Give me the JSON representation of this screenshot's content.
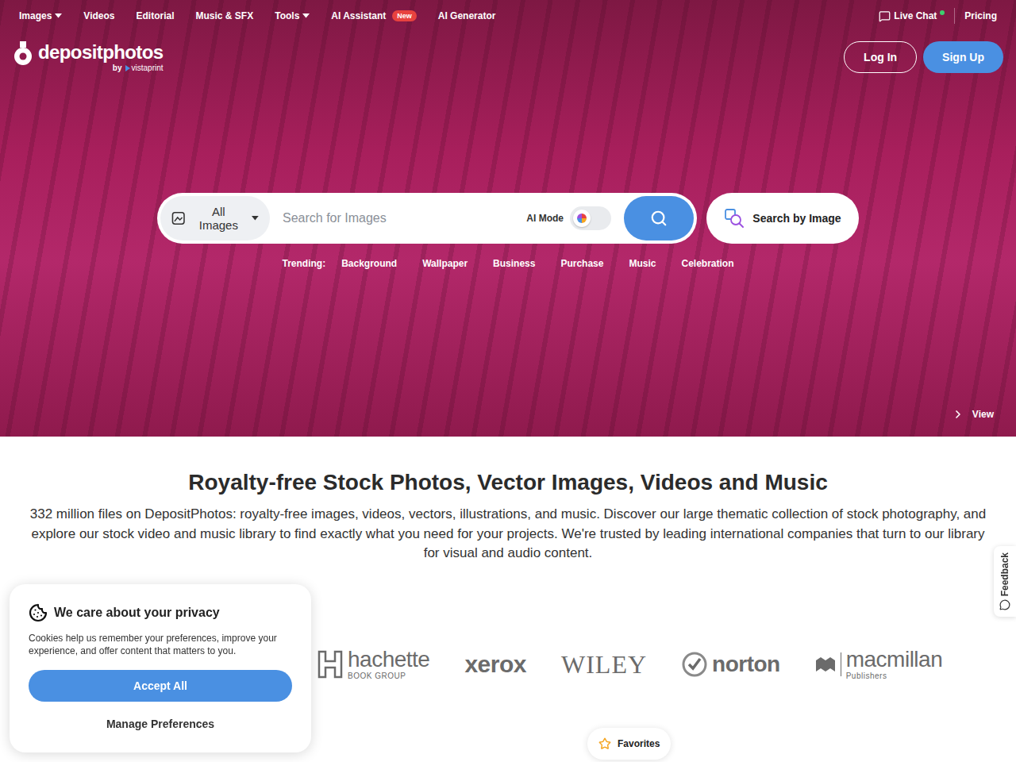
{
  "nav": [
    {
      "label": "Images",
      "kind": "dropdown"
    },
    {
      "label": "Videos",
      "kind": "link"
    },
    {
      "label": "Editorial",
      "kind": "link"
    },
    {
      "label": "Music & SFX",
      "kind": "link"
    },
    {
      "label": "Tools",
      "kind": "dropdown"
    },
    {
      "label": "AI Assistant",
      "kind": "badge",
      "badge": "New"
    },
    {
      "label": "AI Generator",
      "kind": "link"
    }
  ],
  "nav_right": {
    "live_chat": {
      "label": "Live Chat",
      "online": true
    },
    "pricing": "Pricing"
  },
  "logo": {
    "name": "depositphotos",
    "by": "by",
    "partner": "vistaprint"
  },
  "auth": {
    "login": "Log In",
    "signup": "Sign Up"
  },
  "search": {
    "category": "All Images",
    "placeholder": "Search for Images",
    "ai_mode": {
      "label": "AI Mode",
      "on": false
    },
    "by_image": "Search by Image"
  },
  "trending": {
    "label": "Trending:",
    "items": [
      "Background",
      "Wallpaper",
      "Business",
      "Purchase",
      "Music",
      "Celebration"
    ]
  },
  "hero": {
    "view": "View"
  },
  "intro": {
    "title": "Royalty-free Stock Photos, Vector Images, Videos and Music",
    "text": "332 million files on DepositPhotos: royalty-free images, videos, vectors, illustrations, and music. Discover our large thematic collection of stock photography, and explore our stock video and music library to find exactly what you need for your projects. We're trusted by leading international companies that turn to our library for visual and audio content."
  },
  "clients": [
    {
      "name": "hachette",
      "sub": "BOOK GROUP",
      "kind": "hachette"
    },
    {
      "name": "xerox",
      "kind": "xerox"
    },
    {
      "name": "WILEY",
      "kind": "wiley"
    },
    {
      "name": "norton",
      "kind": "norton"
    },
    {
      "name": "macmillan",
      "sub": "Publishers",
      "kind": "macmillan"
    }
  ],
  "favorites": "Favorites",
  "cookie": {
    "title": "We care about your privacy",
    "text": "Cookies help us remember your preferences, improve your experience, and offer content that matters to you.",
    "accept": "Accept All",
    "manage": "Manage Preferences"
  },
  "feedback": "Feedback"
}
